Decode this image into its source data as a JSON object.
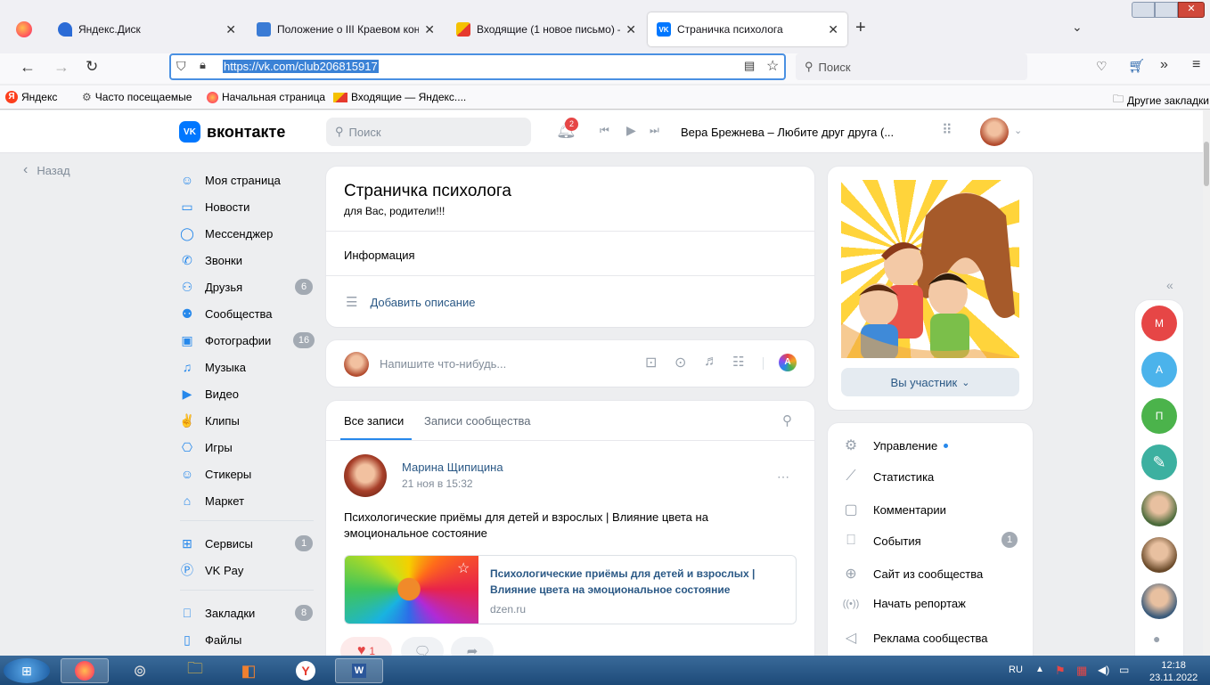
{
  "browser": {
    "tabs": [
      {
        "title": "Яндекс.Диск",
        "color": "#2b6bd6"
      },
      {
        "title": "Положение о III Краевом конк",
        "color": "#3a7bd5"
      },
      {
        "title": "Входящие (1 новое письмо) —",
        "color": "#e8a000"
      },
      {
        "title": "Страничка психолога",
        "color": "#0077ff"
      }
    ],
    "url": "https://vk.com/club206815917",
    "search_placeholder": "Поиск",
    "bookmarks": [
      "Яндекс",
      "Часто посещаемые",
      "Начальная страница",
      "Входящие — Яндекс...."
    ],
    "other_bookmarks": "Другие закладки"
  },
  "vk": {
    "logo": "вконтакте",
    "logo_badge": "VK",
    "search_placeholder": "Поиск",
    "notif_count": "2",
    "player_track": "Вера Брежнева – Любите друг друга (...",
    "back": "Назад",
    "sidebar": [
      {
        "label": "Моя страница",
        "icon": "user-icon",
        "count": ""
      },
      {
        "label": "Новости",
        "icon": "news-icon",
        "count": ""
      },
      {
        "label": "Мессенджер",
        "icon": "messenger-icon",
        "count": ""
      },
      {
        "label": "Звонки",
        "icon": "phone-icon",
        "count": ""
      },
      {
        "label": "Друзья",
        "icon": "friends-icon",
        "count": "6"
      },
      {
        "label": "Сообщества",
        "icon": "groups-icon",
        "count": ""
      },
      {
        "label": "Фотографии",
        "icon": "photo-icon",
        "count": "16"
      },
      {
        "label": "Музыка",
        "icon": "music-icon",
        "count": ""
      },
      {
        "label": "Видео",
        "icon": "video-icon",
        "count": ""
      },
      {
        "label": "Клипы",
        "icon": "clips-icon",
        "count": ""
      },
      {
        "label": "Игры",
        "icon": "games-icon",
        "count": ""
      },
      {
        "label": "Стикеры",
        "icon": "stickers-icon",
        "count": ""
      },
      {
        "label": "Маркет",
        "icon": "market-icon",
        "count": ""
      },
      {
        "label": "Сервисы",
        "icon": "services-icon",
        "count": "1"
      },
      {
        "label": "VK Pay",
        "icon": "vkpay-icon",
        "count": ""
      },
      {
        "label": "Закладки",
        "icon": "bookmark-icon",
        "count": "8"
      },
      {
        "label": "Файлы",
        "icon": "file-icon",
        "count": ""
      }
    ],
    "community": {
      "name": "Страничка психолога",
      "status": "для Вас, родители!!!",
      "info_label": "Информация",
      "add_description": "Добавить описание"
    },
    "composer_placeholder": "Напишите что-нибудь...",
    "composer_badge": "A",
    "wall_tabs": [
      "Все записи",
      "Записи сообщества"
    ],
    "post": {
      "author": "Марина Щипицина",
      "date": "21 ноя в 15:32",
      "text": "Психологические приёмы для детей и взрослых | Влияние цвета на эмоциональное состояние",
      "link_title": "Психологические приёмы для детей и взрослых | Влияние цвета на эмоциональное состояние",
      "link_domain": "dzen.ru",
      "likes": "1"
    },
    "member_button": "Вы участник",
    "right_menu": [
      {
        "label": "Управление",
        "icon": "gear-icon",
        "count": ""
      },
      {
        "label": "Статистика",
        "icon": "stats-icon",
        "count": ""
      },
      {
        "label": "Комментарии",
        "icon": "comment-icon",
        "count": ""
      },
      {
        "label": "События",
        "icon": "events-icon",
        "count": "1"
      },
      {
        "label": "Сайт из сообщества",
        "icon": "globe-icon",
        "count": ""
      },
      {
        "label": "Начать репортаж",
        "icon": "broadcast-icon",
        "count": ""
      },
      {
        "label": "Реклама сообщества",
        "icon": "ads-icon",
        "count": ""
      }
    ],
    "chat_bubbles": [
      {
        "letter": "М",
        "color": "#e64646"
      },
      {
        "letter": "А",
        "color": "#4bb34b"
      },
      {
        "letter": "П",
        "color": "#4bb34b"
      }
    ]
  },
  "taskbar": {
    "lang": "RU",
    "time": "12:18",
    "date": "23.11.2022"
  },
  "colors": {
    "accent": "#2688eb",
    "vk_blue": "#0077ff"
  }
}
